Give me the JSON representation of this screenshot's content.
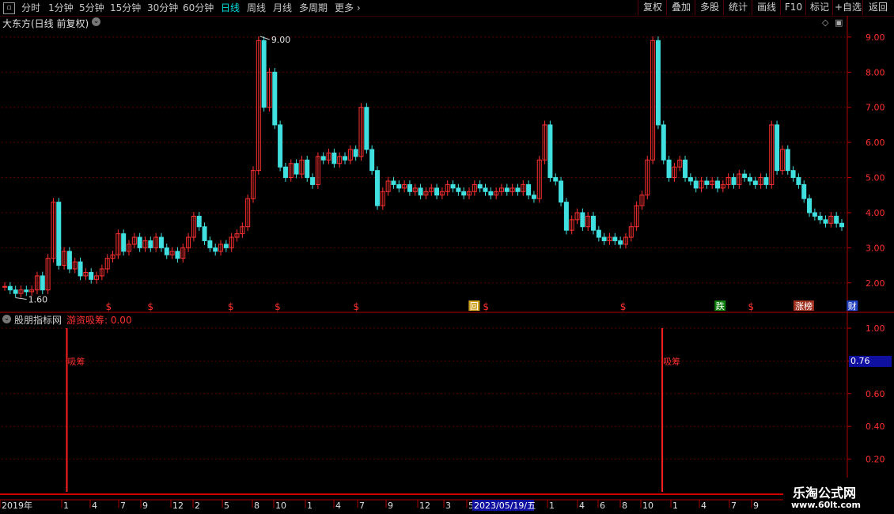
{
  "toolbar": {
    "periods": [
      "分时",
      "1分钟",
      "5分钟",
      "15分钟",
      "30分钟",
      "60分钟",
      "日线",
      "周线",
      "月线",
      "多周期",
      "更多"
    ],
    "active_period": "日线",
    "right_buttons": [
      "复权",
      "叠加",
      "多股",
      "统计",
      "画线",
      "F10",
      "标记",
      "+自选",
      "返回"
    ]
  },
  "main_panel": {
    "title": "大东方(日线 前复权)",
    "high_label": "9.00",
    "low_label": "1.60",
    "event_markers": [
      {
        "label": "$",
        "x_pos": 0.128
      },
      {
        "label": "$",
        "x_pos": 0.178
      },
      {
        "label": "$",
        "x_pos": 0.274
      },
      {
        "label": "$",
        "x_pos": 0.33
      },
      {
        "label": "$",
        "x_pos": 0.424
      },
      {
        "label": "回",
        "x_pos": 0.565
      },
      {
        "label": "$",
        "x_pos": 0.579
      },
      {
        "label": "$",
        "x_pos": 0.743
      },
      {
        "label": "跌",
        "x_pos": 0.859
      },
      {
        "label": "$",
        "x_pos": 0.896
      },
      {
        "label": "涨榜",
        "x_pos": 0.959
      },
      {
        "label": "财",
        "x_pos": 1.017
      }
    ]
  },
  "sub_panel": {
    "title": "股朋指标网",
    "indicator": "游资吸筹: 0.00",
    "signal_label": "吸筹",
    "current_value": "0.76"
  },
  "date_axis": {
    "labels": [
      "2019年",
      "1",
      "4",
      "7",
      "9",
      "12",
      "2",
      "5",
      "8",
      "10",
      "1",
      "4",
      "7",
      "9",
      "12",
      "3",
      "5",
      "8",
      "11",
      "1",
      "4",
      "6",
      "8",
      "10",
      "1",
      "4",
      "7",
      "9"
    ],
    "highlight": "2023/05/19/五"
  },
  "watermark": {
    "line1": "乐淘公式网",
    "line2": "www.60lt.com"
  },
  "chart_data": [
    {
      "type": "line",
      "name_shown": "大东方",
      "ylim": [
        1.5,
        9.2
      ],
      "yticks": [
        2.0,
        3.0,
        4.0,
        5.0,
        6.0,
        7.0,
        8.0,
        9.0
      ],
      "price_path": [
        1.9,
        1.8,
        1.7,
        1.8,
        1.75,
        1.8,
        2.2,
        1.8,
        2.7,
        4.3,
        2.5,
        2.9,
        2.4,
        2.6,
        2.2,
        2.3,
        2.1,
        2.2,
        2.4,
        2.7,
        2.8,
        3.4,
        2.9,
        3.1,
        3.3,
        3.0,
        3.2,
        3.0,
        3.3,
        3.0,
        2.8,
        2.9,
        2.7,
        3.0,
        3.3,
        3.9,
        3.6,
        3.2,
        3.0,
        2.9,
        3.1,
        3.0,
        3.3,
        3.4,
        3.6,
        4.4,
        5.2,
        8.9,
        7.0,
        8.0,
        6.5,
        5.3,
        5.0,
        5.4,
        5.1,
        5.5,
        5.0,
        4.8,
        5.6,
        5.5,
        5.7,
        5.4,
        5.6,
        5.5,
        5.8,
        5.6,
        7.0,
        5.8,
        5.2,
        4.2,
        4.6,
        4.9,
        4.8,
        4.7,
        4.8,
        4.6,
        4.7,
        4.5,
        4.6,
        4.7,
        4.5,
        4.6,
        4.8,
        4.7,
        4.6,
        4.5,
        4.6,
        4.8,
        4.7,
        4.6,
        4.5,
        4.6,
        4.7,
        4.6,
        4.7,
        4.6,
        4.8,
        4.5,
        4.4,
        5.5,
        6.5,
        5.0,
        4.9,
        4.3,
        3.5,
        3.8,
        4.0,
        3.6,
        3.9,
        3.5,
        3.3,
        3.2,
        3.3,
        3.2,
        3.1,
        3.3,
        3.6,
        4.2,
        4.5,
        5.5,
        8.9,
        6.5,
        5.5,
        5.0,
        5.3,
        5.5,
        5.0,
        4.9,
        4.7,
        4.9,
        4.8,
        4.9,
        4.7,
        4.8,
        5.0,
        4.8,
        5.1,
        5.0,
        4.9,
        4.8,
        5.0,
        4.8,
        6.5,
        5.2,
        5.8,
        5.2,
        5.0,
        4.8,
        4.4,
        4.0,
        3.9,
        3.8,
        3.7,
        3.9,
        3.7,
        3.6
      ]
    },
    {
      "type": "bar",
      "name_shown": "游资吸筹",
      "ylim": [
        0,
        1.0
      ],
      "yticks": [
        0.2,
        0.4,
        0.6,
        0.8,
        1.0
      ],
      "signals": [
        {
          "x_pos": 0.073,
          "value": 1.0
        },
        {
          "x_pos": 0.739,
          "value": 1.0
        }
      ]
    }
  ]
}
